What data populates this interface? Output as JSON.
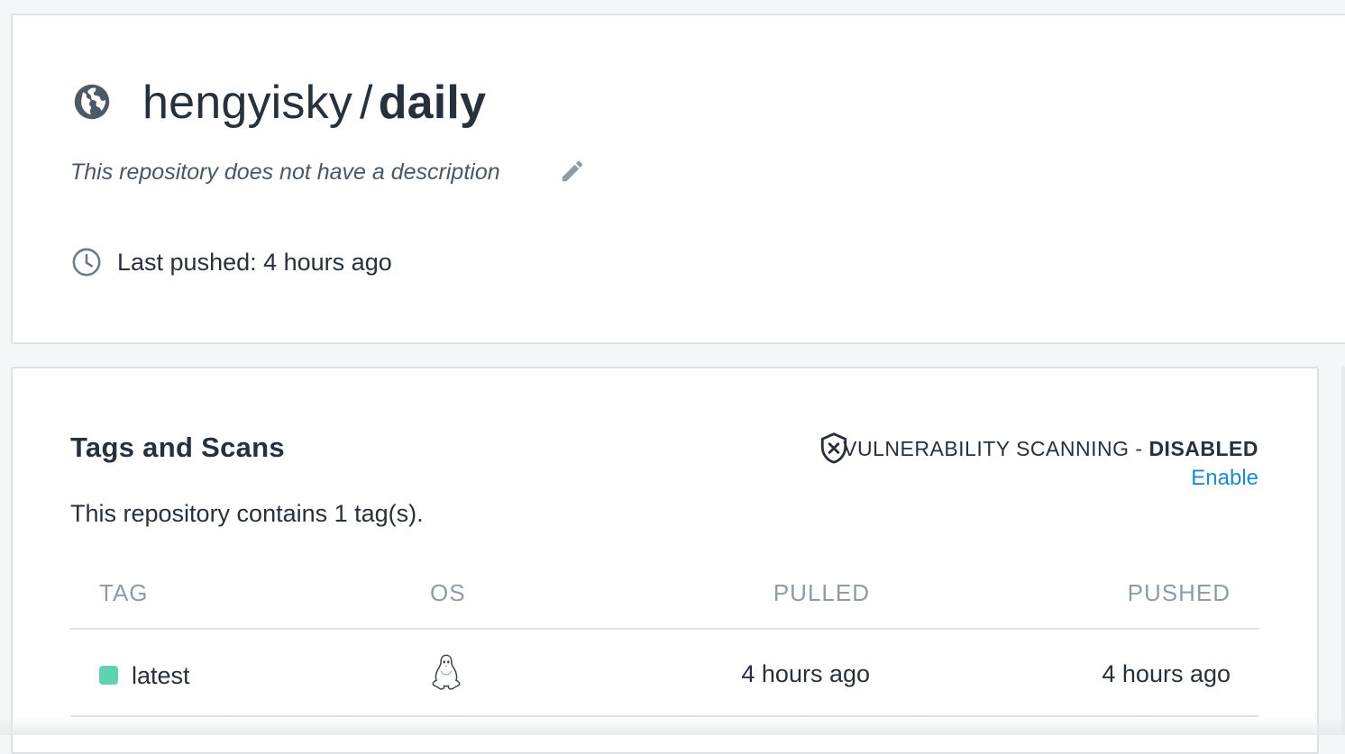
{
  "repo": {
    "namespace": "hengyisky",
    "separator": "/",
    "name": "daily",
    "description": "This repository does not have a description",
    "last_pushed": "Last pushed: 4 hours ago",
    "visibility_icon": "globe-icon"
  },
  "tags_section": {
    "title": "Tags and Scans",
    "vulnerability_label": "VULNERABILITY SCANNING -",
    "vulnerability_status": "DISABLED",
    "enable_label": "Enable",
    "tag_count_text": "This repository contains 1 tag(s).",
    "columns": {
      "tag": "TAG",
      "os": "OS",
      "pulled": "PULLED",
      "pushed": "PUSHED"
    },
    "rows": [
      {
        "tag": "latest",
        "os_icon": "linux-icon",
        "pulled": "4 hours ago",
        "pushed": "4 hours ago",
        "status_color": "#5fd2b1"
      }
    ]
  },
  "colors": {
    "accent_link": "#1a8ad2",
    "text_primary": "#27313b",
    "text_muted": "#8f9ca6",
    "status_ok": "#5fd2b1"
  }
}
